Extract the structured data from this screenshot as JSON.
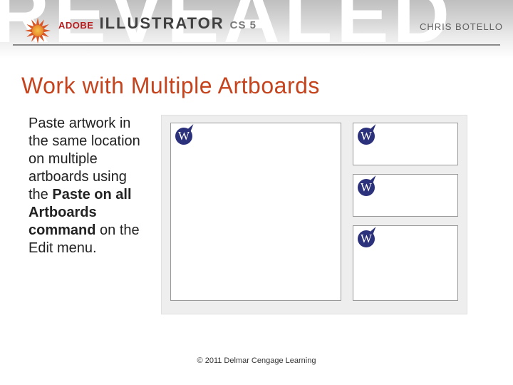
{
  "banner": {
    "bg_word": "REVEALED",
    "brand": {
      "vendor": "ADOBE",
      "product": "ILLUSTRATOR",
      "version": "CS 5"
    },
    "author": "CHRIS BOTELLO"
  },
  "slide": {
    "title": "Work with Multiple Artboards",
    "description": {
      "pre": "Paste artwork in the same location on multiple artboards using the ",
      "bold": "Paste on all Artboards command",
      "post": " on the Edit menu."
    }
  },
  "figure": {
    "artboards": [
      {
        "id": "artboard-1"
      },
      {
        "id": "artboard-2"
      },
      {
        "id": "artboard-3"
      },
      {
        "id": "artboard-4"
      }
    ],
    "mark_letter": "W"
  },
  "footer": {
    "copyright": "© 2011 Delmar Cengage Learning"
  }
}
